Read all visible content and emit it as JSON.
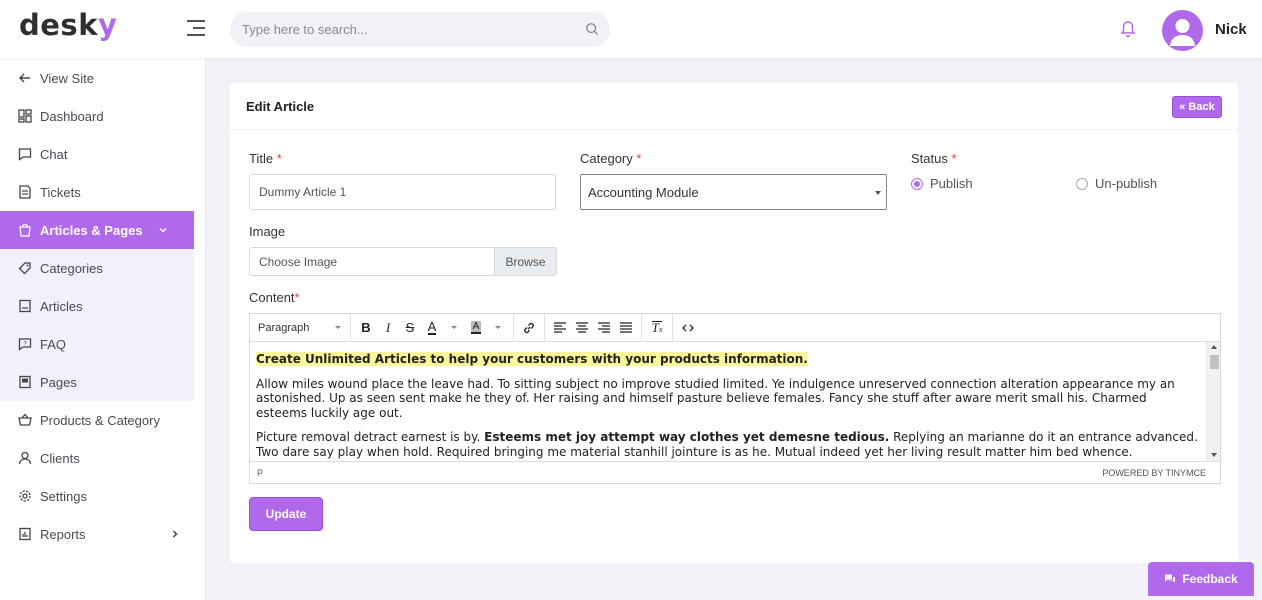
{
  "app": {
    "logo_main": "desk",
    "logo_accent": "y"
  },
  "header": {
    "search_placeholder": "Type here to search...",
    "user_name": "Nick"
  },
  "sidebar": {
    "items": [
      {
        "label": "View Site",
        "icon": "arrow-left-icon"
      },
      {
        "label": "Dashboard",
        "icon": "dashboard-icon"
      },
      {
        "label": "Chat",
        "icon": "chat-icon"
      },
      {
        "label": "Tickets",
        "icon": "tickets-icon"
      },
      {
        "label": "Articles & Pages",
        "icon": "articles-icon",
        "active": true
      },
      {
        "label": "Categories",
        "icon": "tag-icon"
      },
      {
        "label": "Articles",
        "icon": "article-icon"
      },
      {
        "label": "FAQ",
        "icon": "faq-icon"
      },
      {
        "label": "Pages",
        "icon": "pages-icon"
      },
      {
        "label": "Products & Category",
        "icon": "basket-icon"
      },
      {
        "label": "Clients",
        "icon": "user-icon"
      },
      {
        "label": "Settings",
        "icon": "gear-icon"
      },
      {
        "label": "Reports",
        "icon": "report-icon"
      }
    ]
  },
  "card": {
    "title": "Edit Article",
    "back_label": "« Back"
  },
  "form": {
    "title_label": "Title",
    "title_value": "Dummy Article 1",
    "category_label": "Category",
    "category_value": "Accounting Module",
    "status_label": "Status",
    "status_options": [
      "Publish",
      "Un-publish"
    ],
    "status_selected": "Publish",
    "image_label": "Image",
    "image_placeholder": "Choose Image",
    "browse_label": "Browse",
    "content_label": "Content",
    "update_label": "Update"
  },
  "editor": {
    "format_select": "Paragraph",
    "heading_text": "Create Unlimited Articles to help your customers with your products information.",
    "para1": "Allow miles wound place the leave had. To sitting subject no improve studied limited. Ye indulgence unreserved connection alteration appearance my an astonished. Up as seen sent make he they of. Her raising and himself pasture believe females. Fancy she stuff after aware merit small his. Charmed esteems luckily age out.",
    "para2_start": "Picture removal detract earnest is by. ",
    "para2_bold": "Esteems met joy attempt way clothes yet demesne tedious.",
    "para2_end": " Replying an marianne do it an entrance advanced. Two dare say play when hold. Required bringing me material stanhill jointure is as he. Mutual indeed yet her living result matter him bed whence.",
    "path": "P",
    "powered_by": "POWERED BY TINYMCE"
  },
  "feedback_label": "Feedback",
  "colors": {
    "accent": "#b169ec",
    "highlight": "#fdf59a",
    "required": "#e53e3e"
  }
}
